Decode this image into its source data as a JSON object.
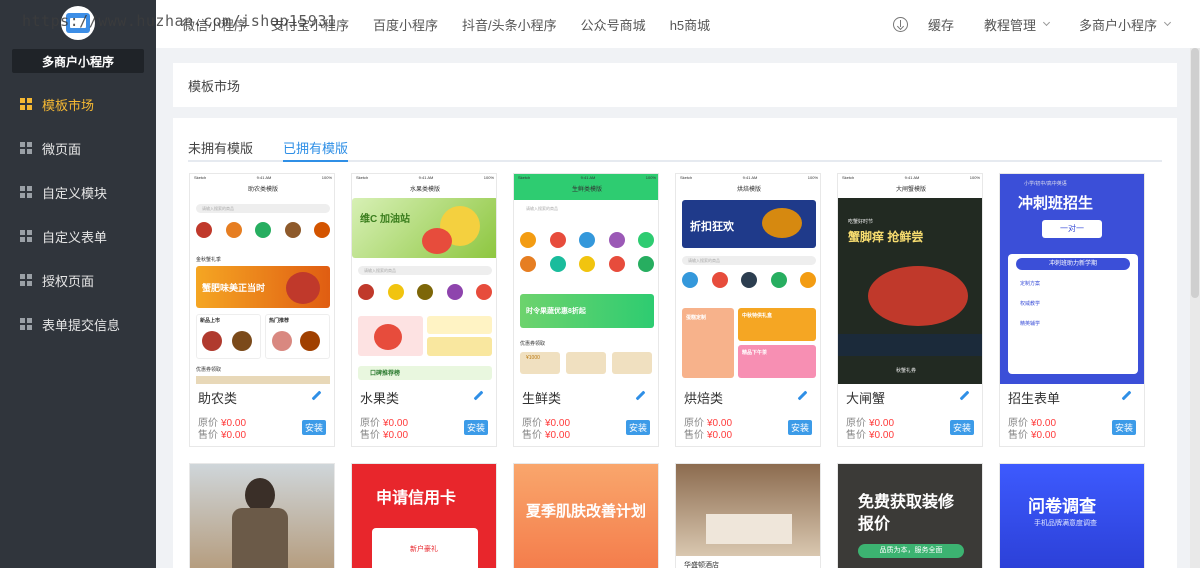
{
  "watermark": "https://www.huzhan.com/ishop15931",
  "sidebar": {
    "brand": "多商户小程序",
    "items": [
      {
        "label": "模板市场",
        "active": true
      },
      {
        "label": "微页面",
        "active": false
      },
      {
        "label": "自定义模块",
        "active": false
      },
      {
        "label": "自定义表单",
        "active": false
      },
      {
        "label": "授权页面",
        "active": false
      },
      {
        "label": "表单提交信息",
        "active": false
      }
    ]
  },
  "topnav": {
    "items": [
      "微信小程序",
      "支付宝小程序",
      "百度小程序",
      "抖音/头条小程序",
      "公众号商城",
      "h5商城"
    ],
    "right": {
      "cache": "缓存",
      "tutorial": "教程管理",
      "account": "多商户小程序"
    }
  },
  "panel": {
    "title": "模板市场",
    "tabs": [
      {
        "label": "未拥有模版",
        "active": false
      },
      {
        "label": "已拥有模版",
        "active": true
      }
    ]
  },
  "labels": {
    "original": "原价",
    "sale": "售价",
    "install": "安装"
  },
  "templates": [
    {
      "name": "助农类",
      "original_price": "¥0.00",
      "sale_price": "¥0.00",
      "screen": {
        "title": "助农类模版",
        "search": "请输入搜索的商品",
        "section": "金秋蟹礼季",
        "promo": "蟹肥味美正当时",
        "cats": [
          "新品上市",
          "热门推荐"
        ],
        "coupon": "优惠券领取"
      }
    },
    {
      "name": "水果类",
      "original_price": "¥0.00",
      "sale_price": "¥0.00",
      "screen": {
        "title": "水果类模版",
        "banner": "维C 加油站",
        "search": "请输入搜索的商品",
        "promo": "口碑推荐榜"
      }
    },
    {
      "name": "生鲜类",
      "original_price": "¥0.00",
      "sale_price": "¥0.00",
      "screen": {
        "title": "生鲜类模版",
        "search": "请输入搜索的商品",
        "promo": "时令果蔬优惠8折起",
        "coupon": "优惠券领取",
        "coupon_value": "¥1000"
      }
    },
    {
      "name": "烘焙类",
      "original_price": "¥0.00",
      "sale_price": "¥0.00",
      "screen": {
        "title": "烘焙模版",
        "banner": "折扣狂欢",
        "search": "请输入搜索的商品",
        "tiles": [
          "蛋糕定制",
          "中秋特供礼盒",
          "精品下午茶"
        ]
      }
    },
    {
      "name": "大闸蟹",
      "original_price": "¥0.00",
      "sale_price": "¥0.00",
      "screen": {
        "title": "大闸蟹模版",
        "headline": "蟹脚痒 抢鲜尝",
        "sub": "吃蟹好时节",
        "footer": "秋蟹礼券"
      }
    },
    {
      "name": "招生表单",
      "original_price": "¥0.00",
      "sale_price": "¥0.00",
      "screen": {
        "title": "小学/初中/高中英语",
        "headline": "冲刺班招生",
        "tag": "一对一",
        "sub": "冲刺班助力新学期",
        "lines": [
          "定制方案",
          "权威教学",
          "精英辅学"
        ]
      }
    }
  ],
  "row2": [
    {
      "caption": ""
    },
    {
      "headline": "申请信用卡",
      "sub": "新户豪礼"
    },
    {
      "headline": "夏季肌肤改善计划"
    },
    {
      "caption": "华盛顿酒店"
    },
    {
      "headline": "免费获取装修报价",
      "sub": "品质为本，服务全面"
    },
    {
      "headline": "问卷调查",
      "sub": "手机品牌满意度调查"
    }
  ],
  "colors": {
    "accent": "#2f8fe6",
    "active_menu": "#f5b833",
    "price": "#ff3b3b",
    "sidebar": "#30353c"
  }
}
